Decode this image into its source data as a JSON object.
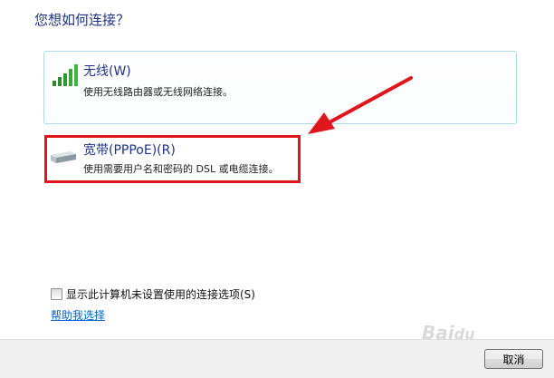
{
  "heading": "您想如何连接？",
  "options": [
    {
      "label": "无线(W)",
      "description": "使用无线路由器或无线网络连接。",
      "icon": "wireless-signal-icon"
    },
    {
      "label": "宽带(PPPoE)(R)",
      "description": "使用需要用户名和密码的 DSL 或电缆连接。",
      "icon": "modem-icon"
    }
  ],
  "show_options_checkbox": {
    "label": "显示此计算机未设置使用的连接选项(S)",
    "checked": false
  },
  "help_link": "帮助我选择",
  "cancel_button": "取消",
  "watermark": "Baidu经验",
  "colors": {
    "heading": "#1e3287",
    "highlight": "#e0161d",
    "link": "#0066cc",
    "selected_border": "#a9dbe8"
  }
}
